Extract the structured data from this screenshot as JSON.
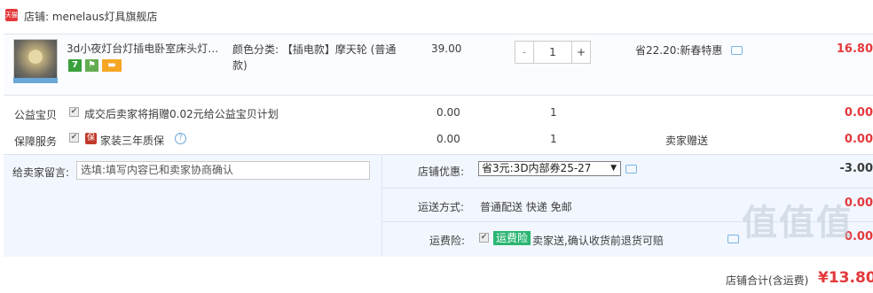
{
  "shop": {
    "badge": "天猫",
    "label": "店铺: menelaus灯具旗舰店"
  },
  "item": {
    "title": "3d小夜灯台灯插电卧室床头灯生...",
    "badges": [
      "7",
      "⚑",
      "▬"
    ],
    "sku": "颜色分类: 【插电款】摩天轮 (普通款)",
    "price": "39.00",
    "qty": {
      "minus": "-",
      "value": "1",
      "plus": "+"
    },
    "promo": "省22.20:新春特惠",
    "subtotal": "16.80"
  },
  "charity": {
    "label": "公益宝贝",
    "text": "成交后卖家将捐赠0.02元给公益宝贝计划",
    "price": "0.00",
    "qty": "1",
    "subtotal": "0.00"
  },
  "warranty": {
    "label": "保障服务",
    "icon_text": "保",
    "text": "家装三年质保",
    "price": "0.00",
    "qty": "1",
    "gift": "卖家赠送",
    "subtotal": "0.00"
  },
  "message": {
    "label": "给卖家留言:",
    "placeholder": "选填:填写内容已和卖家协商确认"
  },
  "discount": {
    "label": "店铺优惠:",
    "selected": "省3元:3D内部券25-27",
    "amount": "-3.00"
  },
  "shipping": {
    "label": "运送方式:",
    "text": "普通配送 快递 免邮",
    "amount": "0.00"
  },
  "insurance": {
    "label": "运费险:",
    "tag": "运费险",
    "text": "卖家送,确认收货前退货可赔",
    "amount": "0.00"
  },
  "total": {
    "label": "店铺合计(含运费)",
    "value": "¥13.80"
  },
  "watermark": "值值值",
  "colors": {
    "red": "#e4393c",
    "blue_bg": "#f2f7ff",
    "green": "#2bb673"
  }
}
